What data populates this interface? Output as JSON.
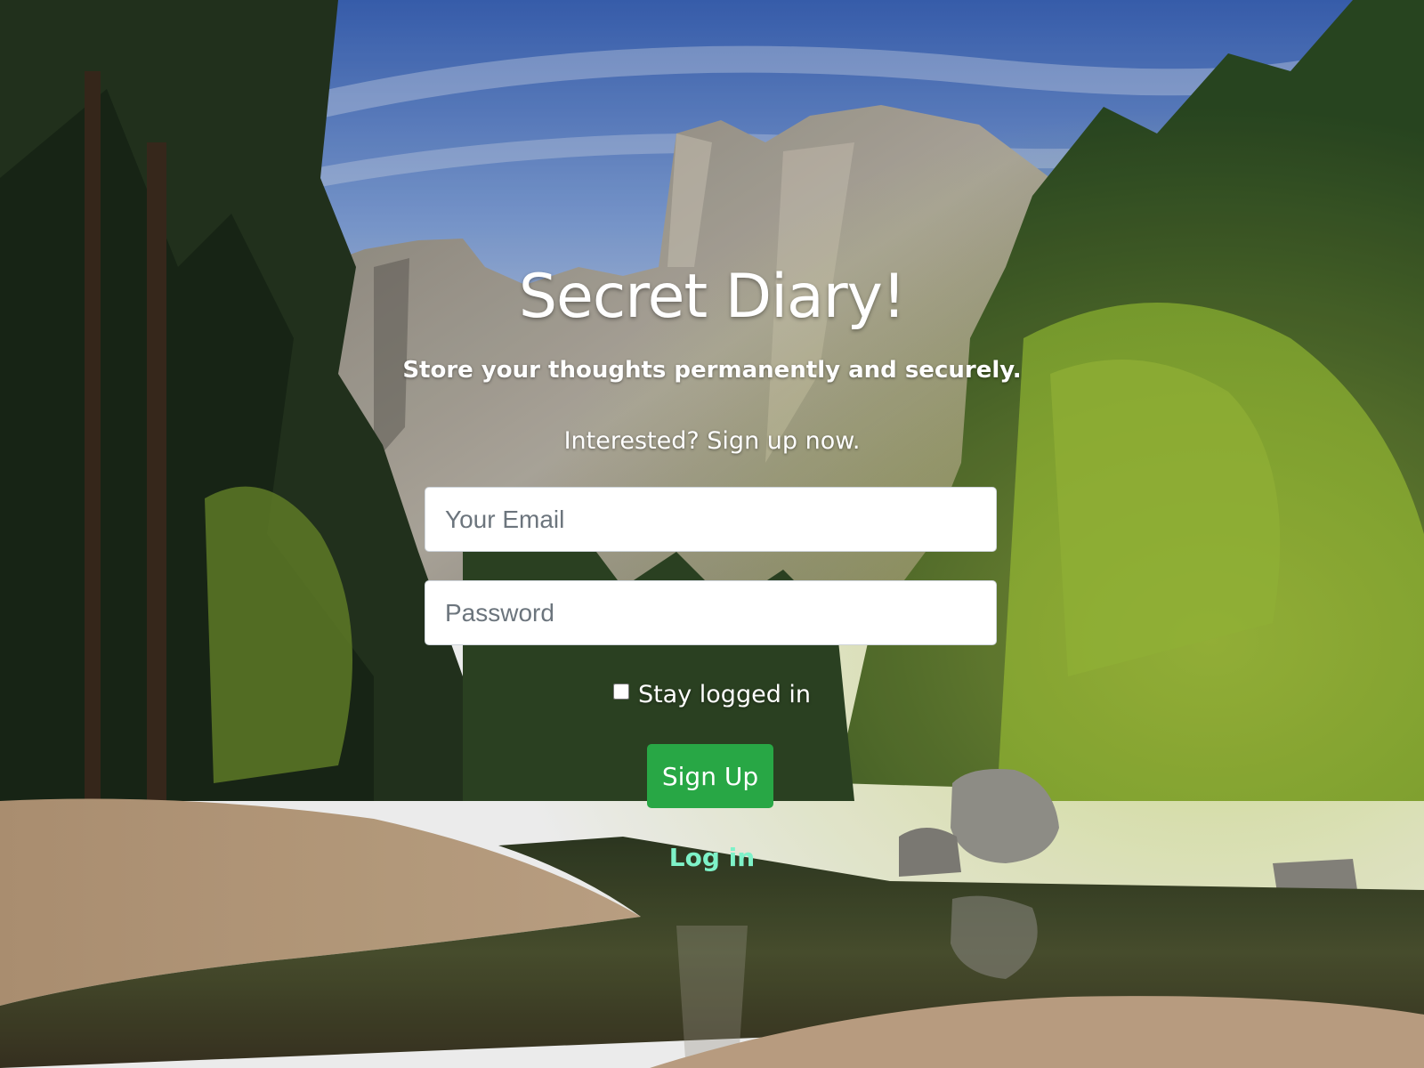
{
  "page": {
    "title": "Secret Diary!",
    "subtitle": "Store your thoughts permanently and securely.",
    "call_to_action": "Interested? Sign up now."
  },
  "form": {
    "email_placeholder": "Your Email",
    "email_value": "",
    "password_placeholder": "Password",
    "password_value": "",
    "stay_logged_in_label": "Stay logged in",
    "stay_logged_in_checked": false,
    "submit_label": "Sign Up",
    "toggle_link_label": "Log in"
  },
  "colors": {
    "submit_button": "#28a745",
    "toggle_link": "#6cf0c0",
    "text": "#ffffff"
  }
}
